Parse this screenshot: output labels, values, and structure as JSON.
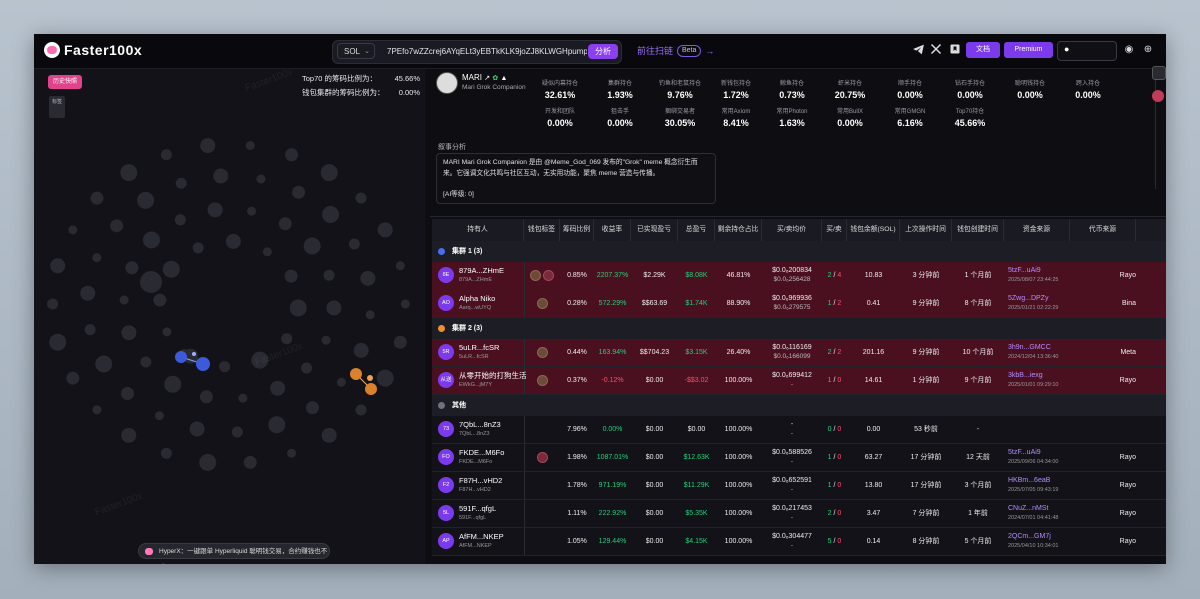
{
  "topbar": {
    "brand": "Faster100x",
    "chain": "SOL",
    "address": "7PEfo7wZZcrej6AYqELt3yEBTkKLK9joZJ8KLWGHpump",
    "analyze": "分析",
    "scan_link": "前往扫链",
    "beta": "Beta",
    "docs": "文档",
    "premium": "Premium"
  },
  "left": {
    "history_button": "历史快照",
    "mini_label": "标签",
    "ratios": [
      {
        "label": "Top70 的筹码比例为：",
        "value": "45.66%"
      },
      {
        "label": "钱包集群的筹码比例为：",
        "value": "0.00%"
      }
    ],
    "banner": "HyperX：一键跟单 Hyperliquid 聪明钱交易，合约赚钱也不难",
    "watermark": "Faster100x"
  },
  "token": {
    "symbol": "MARI",
    "name": "Mari Grok Companion"
  },
  "stats": [
    {
      "label": "疑似内幕持仓",
      "value": "32.61%"
    },
    {
      "label": "集群持仓",
      "value": "1.93%"
    },
    {
      "label": "钓鱼和老鼠持仓",
      "value": "9.76%"
    },
    {
      "label": "新钱包持仓",
      "value": "1.72%"
    },
    {
      "label": "鲸鱼持仓",
      "value": "0.73%"
    },
    {
      "label": "虾米持仓",
      "value": "20.75%"
    },
    {
      "label": "顺手持仓",
      "value": "0.00%"
    },
    {
      "label": "钻石手持仓",
      "value": "0.00%"
    },
    {
      "label": "聪明钱持仓",
      "value": "0.00%"
    },
    {
      "label": "跨入持仓",
      "value": "0.00%"
    },
    {
      "label": "开发和团队",
      "value": "0.00%"
    },
    {
      "label": "狙击手",
      "value": "0.00%"
    },
    {
      "label": "捆绑交易者",
      "value": "30.05%"
    },
    {
      "label": "常用Axiom",
      "value": "8.41%"
    },
    {
      "label": "常用Photon",
      "value": "1.63%"
    },
    {
      "label": "常用BullX",
      "value": "0.00%"
    },
    {
      "label": "常用GMGN",
      "value": "6.16%"
    },
    {
      "label": "Top70持仓",
      "value": "45.66%"
    }
  ],
  "narrative": {
    "title": "叙事分析",
    "text": "MARI Mari Grok Companion 是由 @Meme_God_069 发布的\"Grok\" meme 概念衍生而来。它强调文化共鸣与社区互动，无实用功能，聚焦 meme 营造与传播。",
    "level": "[AI等级: 0]"
  },
  "table": {
    "headers": [
      "持有人",
      "钱包标签",
      "筹码比例",
      "收益率",
      "已实现盈亏",
      "总盈亏",
      "剩余持仓占比",
      "买/卖均价",
      "买/卖",
      "钱包余额(SOL)",
      "上次操作时间",
      "钱包创建时间",
      "资金来源",
      "代币来源"
    ],
    "groups": [
      {
        "label": "集群 1 (3)",
        "color": "#4a6df0"
      },
      {
        "label": "集群 2 (3)",
        "color": "#f0902a"
      },
      {
        "label": "其他",
        "color": "#6b7280"
      }
    ],
    "rows": [
      {
        "av": "8E",
        "name": "879A...ZHmE",
        "sub": "879A...ZHmE",
        "pct": "0.85%",
        "roi": "2207.37%",
        "realized": "$2.29K",
        "total": "$8.08K",
        "remain": "46.81%",
        "buy": "$0.0₆200834",
        "sell": "$0.0₆256428",
        "b": "2",
        "s": "4",
        "bal": "10.83",
        "last": "3 分钟前",
        "created": "1 个月前",
        "fund": "5tzF...uAi9",
        "fdate": "2025/08/07 23:44:25",
        "src": "Rayo"
      },
      {
        "av": "AO",
        "name": "Alpha Niko",
        "sub": "Aarq...wUYQ",
        "pct": "0.28%",
        "roi": "572.29%",
        "realized": "$$63.69",
        "total": "$1.74K",
        "remain": "88.90%",
        "buy": "$0.0₆969936",
        "sell": "$0.0₆279575",
        "b": "1",
        "s": "2",
        "bal": "0.41",
        "last": "9 分钟前",
        "created": "8 个月前",
        "fund": "5Zwg...DPZy",
        "fdate": "2025/01/21 02:22:29",
        "src": "Bina"
      },
      {
        "av": "5R",
        "name": "5uLR...fcSR",
        "sub": "5uLR...fcSR",
        "pct": "0.44%",
        "roi": "163.94%",
        "realized": "$$704.23",
        "total": "$3.15K",
        "remain": "26.40%",
        "buy": "$0.0₆116169",
        "sell": "$0.0₆166099",
        "b": "2",
        "s": "2",
        "bal": "201.16",
        "last": "9 分钟前",
        "created": "10 个月前",
        "fund": "3h9n...GMCC",
        "fdate": "2024/12/04 13:36:40",
        "src": "Meta"
      },
      {
        "av": "从送",
        "name": "从零开始的打狗生活",
        "sub": "EWkG...jM7Y",
        "pct": "0.37%",
        "roi": "-0.12%",
        "realized": "$0.00",
        "total": "-$$3.02",
        "remain": "100.00%",
        "buy": "$0.0₆699412",
        "sell": "-",
        "b": "1",
        "s": "0",
        "bal": "14.61",
        "last": "1 分钟前",
        "created": "9 个月前",
        "fund": "3kbB...iexg",
        "fdate": "2025/01/01 09:29:10",
        "src": "Rayo"
      },
      {
        "av": "73",
        "name": "7QbL...8nZ3",
        "sub": "7QbL...8nZ3",
        "pct": "7.96%",
        "roi": "0.00%",
        "realized": "$0.00",
        "total": "$0.00",
        "remain": "100.00%",
        "buy": "-",
        "sell": "-",
        "b": "0",
        "s": "0",
        "bal": "0.00",
        "last": "53 秒前",
        "created": "-",
        "fund": "",
        "fdate": "",
        "src": ""
      },
      {
        "av": "FO",
        "name": "FKDE...M6Fo",
        "sub": "FKDE...M6Fo",
        "pct": "1.98%",
        "roi": "1087.01%",
        "realized": "$0.00",
        "total": "$12.63K",
        "remain": "100.00%",
        "buy": "$0.0₆588526",
        "sell": "-",
        "b": "1",
        "s": "0",
        "bal": "63.27",
        "last": "17 分钟前",
        "created": "12 天前",
        "fund": "5tzF...uAi9",
        "fdate": "2025/09/06 04:34:00",
        "src": "Rayo"
      },
      {
        "av": "F2",
        "name": "F87H...vHD2",
        "sub": "F87H...vHD2",
        "pct": "1.78%",
        "roi": "971.19%",
        "realized": "$0.00",
        "total": "$11.29K",
        "remain": "100.00%",
        "buy": "$0.0₆652591",
        "sell": "-",
        "b": "1",
        "s": "0",
        "bal": "13.80",
        "last": "17 分钟前",
        "created": "3 个月前",
        "fund": "HKBm...6eaB",
        "fdate": "2025/07/05 09:43:19",
        "src": "Rayo"
      },
      {
        "av": "5L",
        "name": "591F...qfgL",
        "sub": "591F...qfgL",
        "pct": "1.11%",
        "roi": "222.92%",
        "realized": "$0.00",
        "total": "$5.35K",
        "remain": "100.00%",
        "buy": "$0.0₆217453",
        "sell": "-",
        "b": "2",
        "s": "0",
        "bal": "3.47",
        "last": "7 分钟前",
        "created": "1 年前",
        "fund": "CNuZ...nMSt",
        "fdate": "2024/07/01 04:41:48",
        "src": "Rayo"
      },
      {
        "av": "AP",
        "name": "AfFM...NKEP",
        "sub": "AfFM...NKEP",
        "pct": "1.05%",
        "roi": "129.44%",
        "realized": "$0.00",
        "total": "$4.15K",
        "remain": "100.00%",
        "buy": "$0.0₆304477",
        "sell": "-",
        "b": "5",
        "s": "0",
        "bal": "0.14",
        "last": "8 分钟前",
        "created": "5 个月前",
        "fund": "2QCm...GM7j",
        "fdate": "2025/04/10 10:34:01",
        "src": "Rayo"
      }
    ]
  },
  "colors": {
    "accent": "#7c3aed",
    "positive": "#21d07a",
    "negative": "#ff4d6a",
    "cluster_row": "#4a1020"
  }
}
